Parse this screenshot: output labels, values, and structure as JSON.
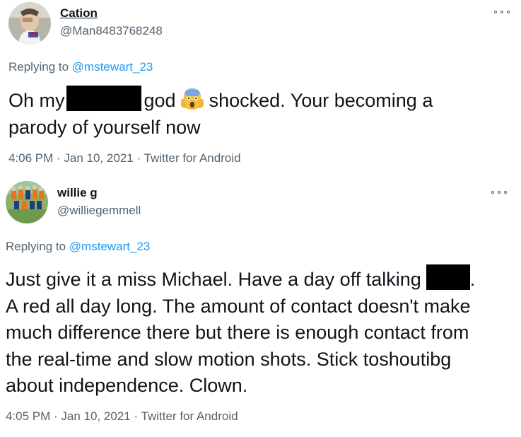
{
  "tweets": [
    {
      "display_name": "Cation",
      "handle": "@Man8483768248",
      "replying_prefix": "Replying to ",
      "replying_to": "@mstewart_23",
      "text_part1": "Oh my",
      "text_part2": "god",
      "text_part3": "shocked. Your becoming a",
      "text_line2": "parody of yourself now",
      "time": "4:06 PM",
      "date": "Jan 10, 2021",
      "source": "Twitter for Android",
      "sep": " · "
    },
    {
      "display_name": "willie g",
      "handle": "@williegemmell",
      "replying_prefix": "Replying to ",
      "replying_to": "@mstewart_23",
      "line1_part1": "Just give it a miss Michael. Have a day off talking",
      "line1_part2": ".",
      "line2": "A red all day long. The amount of contact doesn't make",
      "line3": "much difference there but there is enough contact from",
      "line4": "the real-time and slow motion shots. Stick toshoutibg",
      "line5": "about independence. Clown.",
      "time": "4:05 PM",
      "date": "Jan 10, 2021",
      "source": "Twitter for Android",
      "sep": " · "
    }
  ],
  "icons": {
    "more": "more-horizontal-icon",
    "shocked_emoji": "face-screaming-in-fear"
  },
  "colors": {
    "text": "#0f1419",
    "secondary": "#536471",
    "link": "#1d9bf0"
  }
}
